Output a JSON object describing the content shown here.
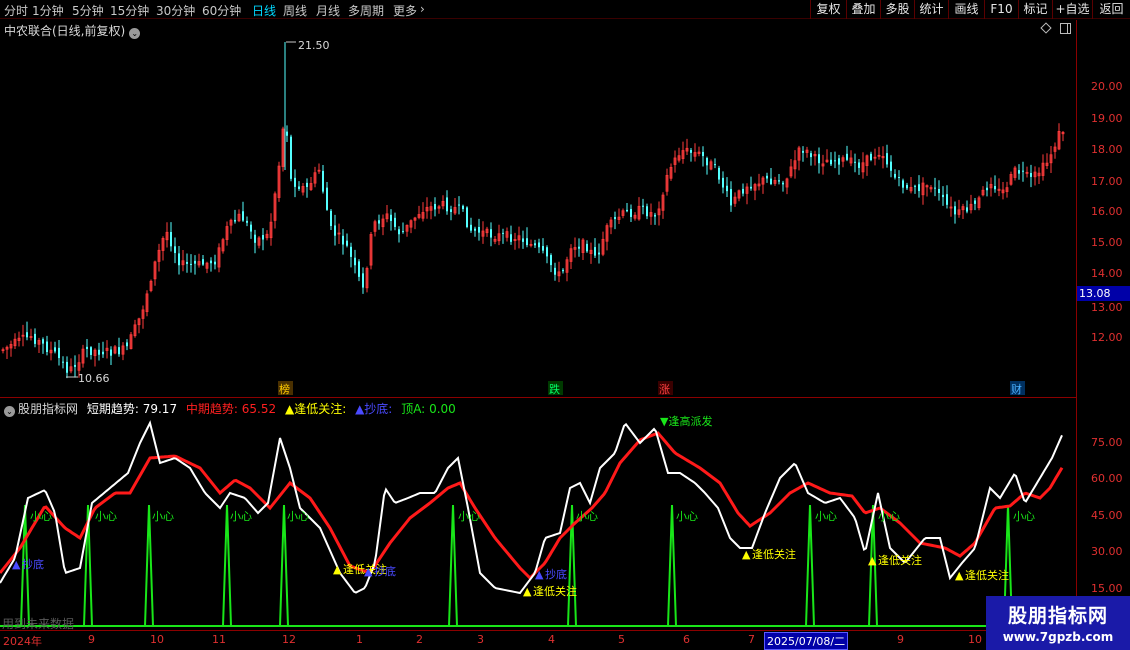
{
  "toolbar": {
    "periods": [
      {
        "label": "分时",
        "active": false
      },
      {
        "label": "1分钟",
        "active": false
      },
      {
        "label": "5分钟",
        "active": false
      },
      {
        "label": "15分钟",
        "active": false
      },
      {
        "label": "30分钟",
        "active": false
      },
      {
        "label": "60分钟",
        "active": false
      },
      {
        "label": "日线",
        "active": true
      },
      {
        "label": "周线",
        "active": false
      },
      {
        "label": "月线",
        "active": false
      },
      {
        "label": "多周期",
        "active": false
      },
      {
        "label": "更多",
        "active": false
      }
    ],
    "more_chevron": "chevron-right-icon",
    "buttons": [
      "复权",
      "叠加",
      "多股",
      "统计",
      "画线",
      "F10",
      "标记",
      "+自选",
      "返回"
    ]
  },
  "price_panel": {
    "title": "中农联合(日线,前复权)",
    "dropdown_icon": "chevron-down-icon",
    "high_annotation": "21.50",
    "low_annotation": "10.66",
    "event_markers": [
      "榜",
      "跌",
      "涨",
      "财"
    ],
    "current_price": "13.08",
    "axis_labels": [
      "20.00",
      "19.00",
      "18.00",
      "17.00",
      "16.00",
      "15.00",
      "14.00",
      "13.00",
      "12.00"
    ],
    "colors": {
      "up": "#ff3c3c",
      "down": "#54ffff",
      "axis": "#e03030"
    }
  },
  "indicator_panel": {
    "name": "股朋指标网",
    "short_trend_label": "短期趋势:",
    "short_trend_value": "79.17",
    "mid_trend_label": "中期趋势:",
    "mid_trend_value": "65.52",
    "low_focus_label": "▲逢低关注:",
    "bottom_label": "▲抄底:",
    "top_label": "顶A:",
    "top_value": "0.00",
    "axis_labels": [
      "75.00",
      "60.00",
      "45.00",
      "30.00",
      "15.00"
    ],
    "signal_labels": {
      "caution": "小心",
      "low_focus": "逢低关注",
      "bottom": "抄底",
      "high_sell": "▼逢高派发"
    },
    "colors": {
      "short": "#ffffff",
      "mid": "#ff1a1a",
      "signal": "#19e619",
      "low_focus": "#ffff00",
      "bottom": "#3a3aff"
    }
  },
  "date_axis": {
    "labels": [
      "2024年",
      "9",
      "10",
      "11",
      "12",
      "1",
      "2",
      "3",
      "4",
      "5",
      "6",
      "7",
      "9",
      "10"
    ],
    "cursor_date": "2025/07/08/二"
  },
  "watermark": {
    "title": "股朋指标网",
    "url": "www.7gpzb.com"
  },
  "bottom_hint": "用到未来数据"
}
